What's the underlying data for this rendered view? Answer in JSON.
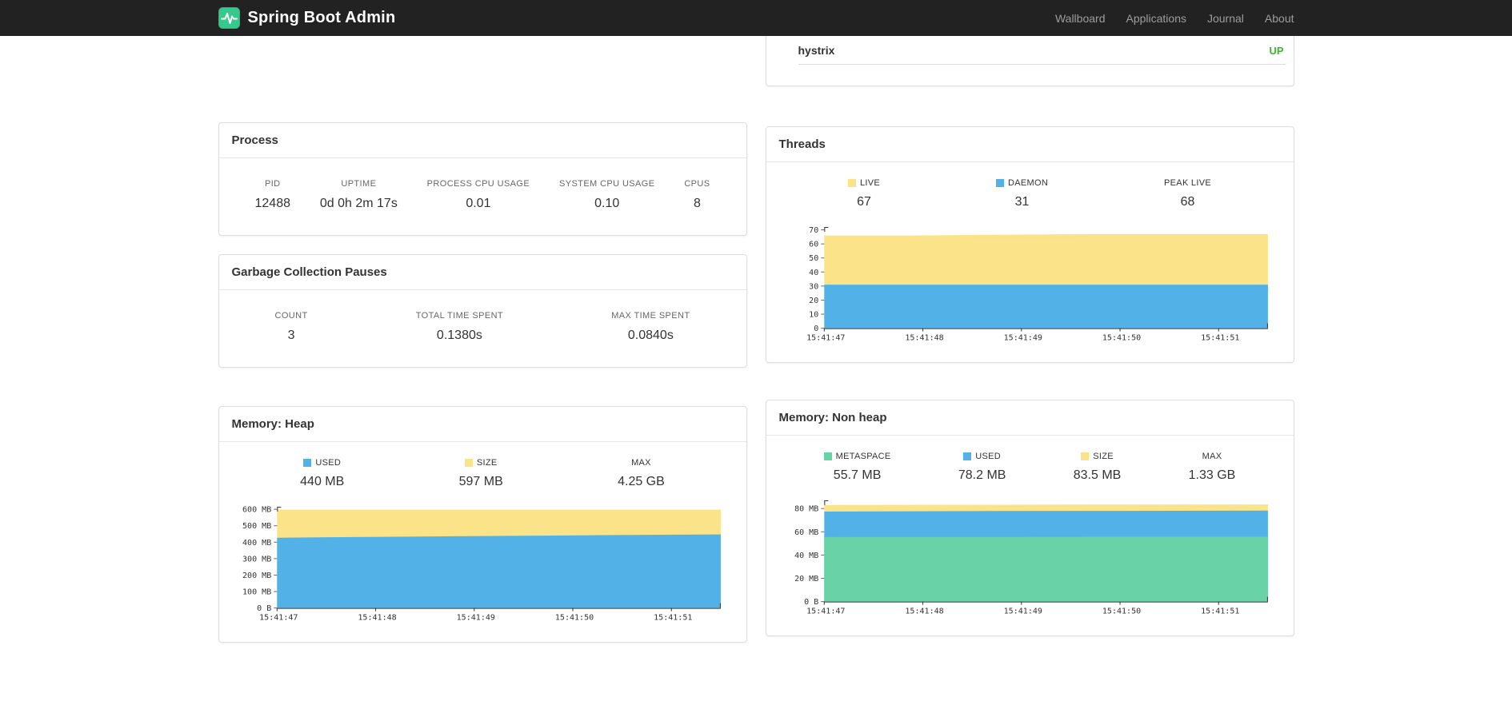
{
  "navbar": {
    "title": "Spring Boot Admin",
    "logo_color": "#35c98e",
    "links": [
      {
        "label": "Wallboard"
      },
      {
        "label": "Applications"
      },
      {
        "label": "Journal"
      },
      {
        "label": "About"
      }
    ]
  },
  "health_panel": {
    "item": "hystrix",
    "status": "UP",
    "status_color": "#3cb52e"
  },
  "palette": {
    "yellow": "#FBE38A",
    "blue": "#52B2E8",
    "green": "#69D2A7"
  },
  "cards": {
    "process": {
      "title": "Process",
      "metrics": [
        {
          "label": "PID",
          "value": "12488"
        },
        {
          "label": "UPTIME",
          "value": "0d 0h 2m 17s"
        },
        {
          "label": "PROCESS CPU USAGE",
          "value": "0.01"
        },
        {
          "label": "SYSTEM CPU USAGE",
          "value": "0.10"
        },
        {
          "label": "CPUS",
          "value": "8"
        }
      ]
    },
    "gc": {
      "title": "Garbage Collection Pauses",
      "metrics": [
        {
          "label": "COUNT",
          "value": "3"
        },
        {
          "label": "TOTAL TIME SPENT",
          "value": "0.1380s"
        },
        {
          "label": "MAX TIME SPENT",
          "value": "0.0840s"
        }
      ]
    },
    "threads": {
      "title": "Threads",
      "legend": [
        {
          "label": "LIVE",
          "value": "67",
          "color": "#FBE38A"
        },
        {
          "label": "DAEMON",
          "value": "31",
          "color": "#52B2E8"
        },
        {
          "label": "PEAK LIVE",
          "value": "68",
          "color": ""
        }
      ]
    },
    "heap": {
      "title": "Memory: Heap",
      "legend": [
        {
          "label": "USED",
          "value": "440 MB",
          "color": "#52B2E8"
        },
        {
          "label": "SIZE",
          "value": "597 MB",
          "color": "#FBE38A"
        },
        {
          "label": "MAX",
          "value": "4.25 GB",
          "color": ""
        }
      ]
    },
    "nonheap": {
      "title": "Memory: Non heap",
      "legend": [
        {
          "label": "METASPACE",
          "value": "55.7 MB",
          "color": "#69D2A7"
        },
        {
          "label": "USED",
          "value": "78.2 MB",
          "color": "#52B2E8"
        },
        {
          "label": "SIZE",
          "value": "83.5 MB",
          "color": "#FBE38A"
        },
        {
          "label": "MAX",
          "value": "1.33 GB",
          "color": ""
        }
      ]
    }
  },
  "chart_data": [
    {
      "id": "threads",
      "type": "area",
      "title": "Threads",
      "x_ticks": [
        "15:41:47",
        "15:41:48",
        "15:41:49",
        "15:41:50",
        "15:41:51"
      ],
      "ylim": [
        0,
        72
      ],
      "y_ticks": [
        {
          "v": 0,
          "label": "0"
        },
        {
          "v": 10,
          "label": "10"
        },
        {
          "v": 20,
          "label": "20"
        },
        {
          "v": 30,
          "label": "30"
        },
        {
          "v": 40,
          "label": "40"
        },
        {
          "v": 50,
          "label": "50"
        },
        {
          "v": 60,
          "label": "60"
        },
        {
          "v": 70,
          "label": "70"
        }
      ],
      "series": [
        {
          "name": "LIVE",
          "color": "#FBE38A",
          "values": [
            66,
            66,
            66.5,
            67,
            67,
            67
          ]
        },
        {
          "name": "DAEMON",
          "color": "#52B2E8",
          "values": [
            31,
            31,
            31,
            31,
            31,
            31
          ]
        }
      ]
    },
    {
      "id": "heap",
      "type": "area",
      "title": "Memory: Heap",
      "x_ticks": [
        "15:41:47",
        "15:41:48",
        "15:41:49",
        "15:41:50",
        "15:41:51"
      ],
      "ylim": [
        0,
        615
      ],
      "y_ticks": [
        {
          "v": 0,
          "label": "0 B"
        },
        {
          "v": 100,
          "label": "100 MB"
        },
        {
          "v": 200,
          "label": "200 MB"
        },
        {
          "v": 300,
          "label": "300 MB"
        },
        {
          "v": 400,
          "label": "400 MB"
        },
        {
          "v": 500,
          "label": "500 MB"
        },
        {
          "v": 600,
          "label": "600 MB"
        }
      ],
      "series": [
        {
          "name": "SIZE",
          "color": "#FBE38A",
          "values": [
            597,
            597,
            597,
            597,
            597,
            597
          ]
        },
        {
          "name": "USED",
          "color": "#52B2E8",
          "values": [
            427,
            432,
            436,
            440,
            444,
            447
          ]
        }
      ]
    },
    {
      "id": "nonheap",
      "type": "area",
      "title": "Memory: Non heap",
      "x_ticks": [
        "15:41:47",
        "15:41:48",
        "15:41:49",
        "15:41:50",
        "15:41:51"
      ],
      "ylim": [
        0,
        87
      ],
      "y_ticks": [
        {
          "v": 0,
          "label": "0 B"
        },
        {
          "v": 20,
          "label": "20 MB"
        },
        {
          "v": 40,
          "label": "40 MB"
        },
        {
          "v": 60,
          "label": "60 MB"
        },
        {
          "v": 80,
          "label": "80 MB"
        }
      ],
      "series": [
        {
          "name": "SIZE",
          "color": "#FBE38A",
          "values": [
            83,
            83.2,
            83.3,
            83.5,
            83.5,
            83.5
          ]
        },
        {
          "name": "USED",
          "color": "#52B2E8",
          "values": [
            77.4,
            77.7,
            77.9,
            78,
            78.1,
            78.2
          ]
        },
        {
          "name": "METASPACE",
          "color": "#69D2A7",
          "values": [
            55.5,
            55.6,
            55.6,
            55.7,
            55.7,
            55.7
          ]
        }
      ]
    }
  ]
}
